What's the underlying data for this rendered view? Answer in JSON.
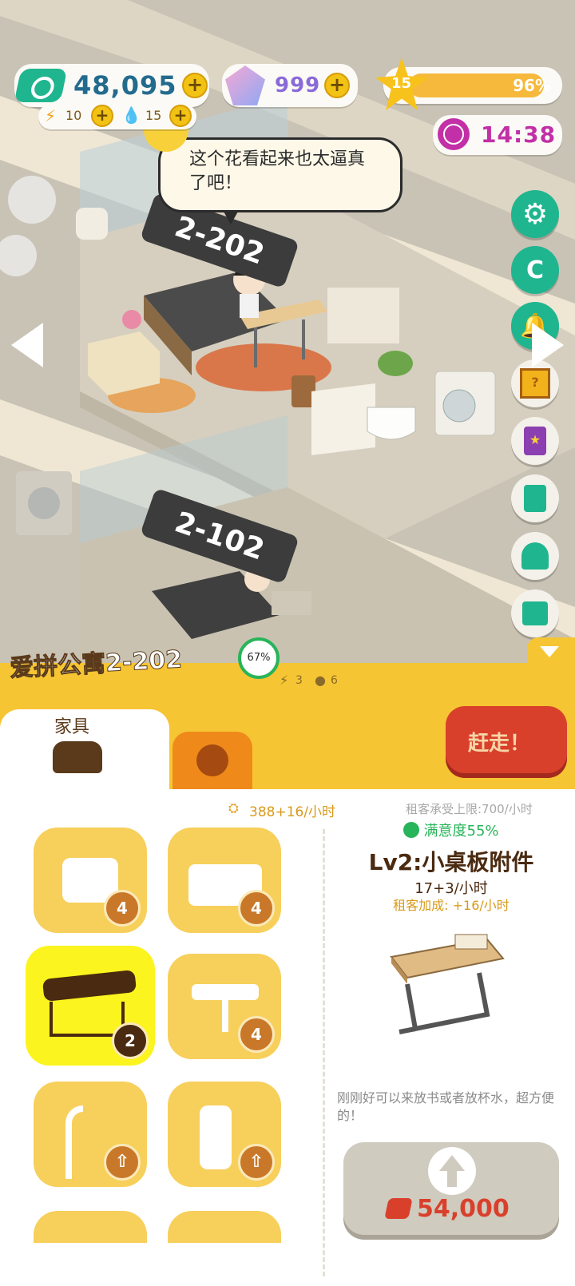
{
  "hud": {
    "cash": "48,095",
    "gems": "999",
    "energy": "10",
    "water": "15",
    "level": "15",
    "level_progress_label": "96%",
    "level_progress": 0.96,
    "clock": "14:38"
  },
  "speech_bubble": "这个花看起来也太逼真了吧！",
  "rooms": {
    "upper_label": "2-202",
    "lower_label": "2-102"
  },
  "apartment": {
    "name": "爱拼公寓2-202",
    "satisfaction_ring": "67%",
    "satisfaction_ring_value": 0.67,
    "energy_cost": "3",
    "water_cost": "6"
  },
  "side_buttons": [
    "gear-icon",
    "coin-icon",
    "bell-icon",
    "mystery-box-icon",
    "book-icon",
    "notes-icon",
    "ghost-icon",
    "gift-icon"
  ],
  "tabs": {
    "furniture_label": "家具",
    "evict_label": "赶走！"
  },
  "income": {
    "rate": "388+16/小时",
    "limit": "租客承受上限:700/小时"
  },
  "tiles": [
    {
      "icon": "bed-icon",
      "badge": "4"
    },
    {
      "icon": "cabinet-icon",
      "badge": "4"
    },
    {
      "icon": "side-table-icon",
      "badge": "2"
    },
    {
      "icon": "table-chair-icon",
      "badge": "4"
    },
    {
      "icon": "shower-icon",
      "badge": "upgrade"
    },
    {
      "icon": "toilet-icon",
      "badge": "upgrade"
    }
  ],
  "detail": {
    "satisfaction": "满意度55%",
    "title": "Lv2:小桌板附件",
    "rate": "17+3/小时",
    "bonus": "租客加成: +16/小时",
    "description": "刚刚好可以来放书或者放杯水，超方便的！",
    "upgrade_cost": "54,000"
  },
  "colors": {
    "accent_yellow": "#f6c533",
    "hud_green": "#1fb58f",
    "evict_red": "#d9402c",
    "text_brown": "#5a3a1a"
  }
}
